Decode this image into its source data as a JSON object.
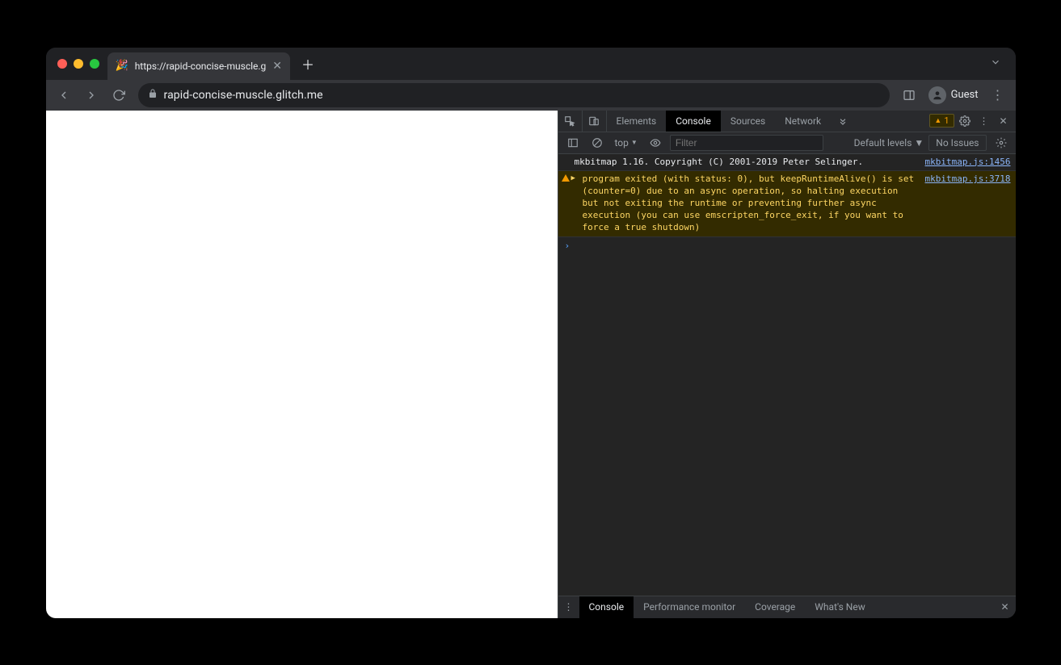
{
  "tab": {
    "favicon": "🎉",
    "title": "https://rapid-concise-muscle.g"
  },
  "url": "rapid-concise-muscle.glitch.me",
  "guest_label": "Guest",
  "devtools": {
    "tabs": [
      "Elements",
      "Console",
      "Sources",
      "Network"
    ],
    "active_tab": "Console",
    "warn_count": "1",
    "console_toolbar": {
      "context": "top",
      "filter_placeholder": "Filter",
      "levels_label": "Default levels",
      "issues_label": "No Issues"
    },
    "logs": [
      {
        "type": "log",
        "msg": "mkbitmap 1.16. Copyright (C) 2001-2019 Peter Selinger.",
        "src": "mkbitmap.js:1456"
      },
      {
        "type": "warn",
        "msg": "program exited (with status: 0), but keepRuntimeAlive() is set (counter=0) due to an async operation, so halting execution but not exiting the runtime or preventing further async execution (you can use emscripten_force_exit, if you want to force a true shutdown)",
        "src": "mkbitmap.js:3718"
      }
    ],
    "drawer_tabs": [
      "Console",
      "Performance monitor",
      "Coverage",
      "What's New"
    ],
    "drawer_active": "Console"
  }
}
